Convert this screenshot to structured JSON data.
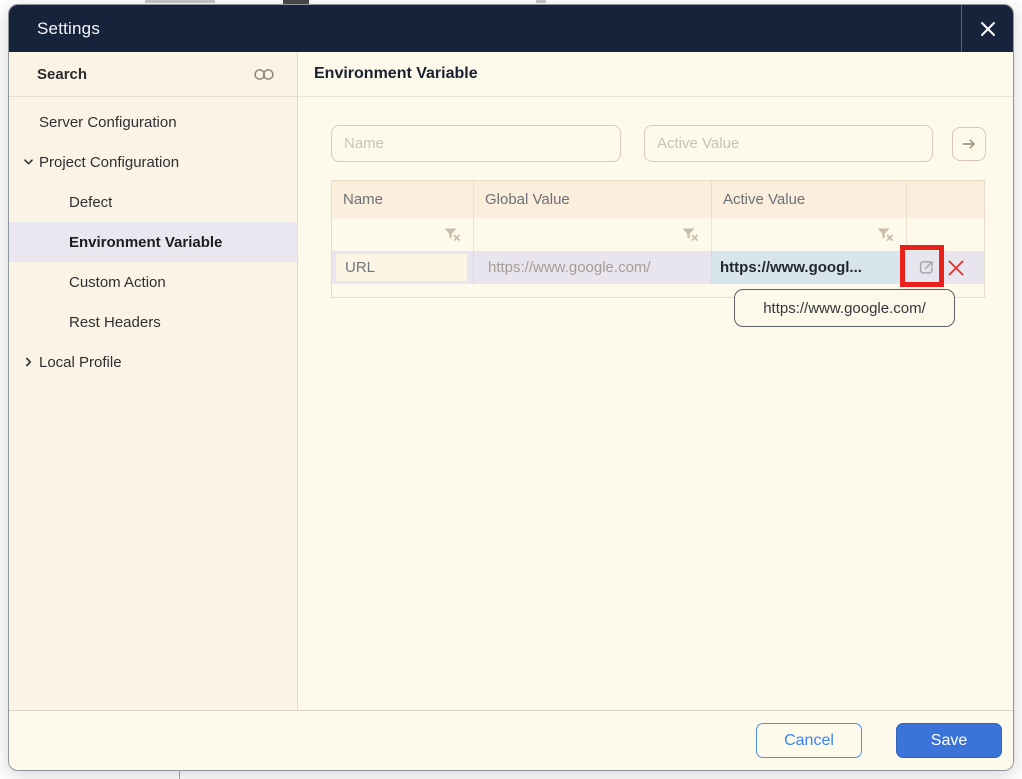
{
  "window": {
    "title": "Settings"
  },
  "sidebar": {
    "search": {
      "label": "Search"
    },
    "items": [
      {
        "label": "Server Configuration",
        "level": 0,
        "chevron": "none",
        "selected": false
      },
      {
        "label": "Project Configuration",
        "level": 0,
        "chevron": "down",
        "selected": false
      },
      {
        "label": "Defect",
        "level": 1,
        "chevron": "none",
        "selected": false
      },
      {
        "label": "Environment Variable",
        "level": 1,
        "chevron": "none",
        "selected": true
      },
      {
        "label": "Custom Action",
        "level": 1,
        "chevron": "none",
        "selected": false
      },
      {
        "label": "Rest Headers",
        "level": 1,
        "chevron": "none",
        "selected": false
      },
      {
        "label": "Local Profile",
        "level": 0,
        "chevron": "right",
        "selected": false
      }
    ]
  },
  "main": {
    "title": "Environment Variable",
    "add_form": {
      "name_placeholder": "Name",
      "active_value_placeholder": "Active Value",
      "submit_icon": "arrow-right"
    },
    "table": {
      "columns": [
        "Name",
        "Global Value",
        "Active Value",
        ""
      ],
      "filter_icon": "filter-clear",
      "rows": [
        {
          "name": "URL",
          "global_value": "https://www.google.com/",
          "active_value": "https://www.googl...",
          "actions": [
            "open-share",
            "delete"
          ]
        }
      ]
    },
    "tooltip": "https://www.google.com/",
    "annotation": {
      "shape": "red-box",
      "target": "open-share-icon"
    }
  },
  "footer": {
    "cancel_label": "Cancel",
    "save_label": "Save"
  },
  "colors": {
    "titlebar": "#16233a",
    "sidebar_bg": "#fbf3e6",
    "main_bg": "#fdfaeb",
    "selected_item_bg": "#ebe7f0",
    "table_header_bg": "#fbeedc",
    "data_row_bg": "#e9e5ee",
    "active_cell_bg": "#d9e5ec",
    "name_cell_bg": "#fcf5e4",
    "annotation_red": "#e8211c",
    "delete_red": "#e23126",
    "save_blue": "#3a74d8",
    "cancel_blue": "#3b82f6"
  }
}
